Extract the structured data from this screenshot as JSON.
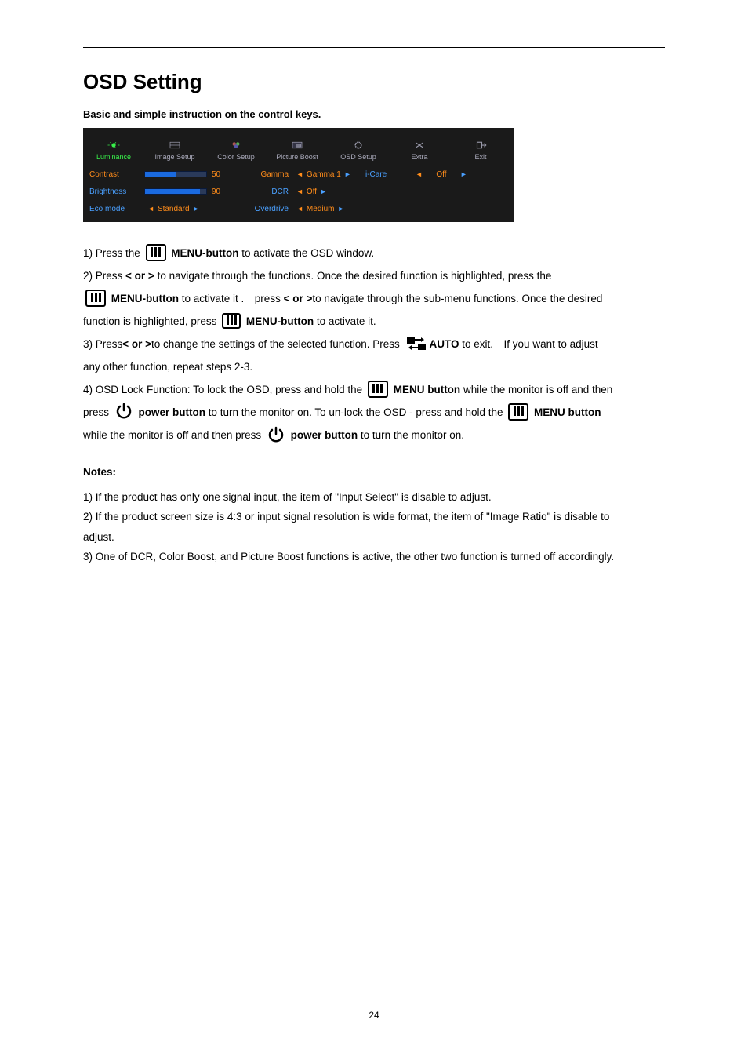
{
  "title": "OSD Setting",
  "subhead": "Basic and simple instruction on the control keys.",
  "page_number": "24",
  "osd": {
    "tabs": [
      "Luminance",
      "Image Setup",
      "Color Setup",
      "Picture Boost",
      "OSD Setup",
      "Extra",
      "Exit"
    ],
    "rows": [
      {
        "label": "Contrast",
        "value": "50"
      },
      {
        "label": "Brightness",
        "value": "90"
      },
      {
        "label": "Eco mode",
        "value": "Standard"
      }
    ],
    "rows2": [
      {
        "label": "Gamma",
        "value": "Gamma 1"
      },
      {
        "label": "DCR",
        "value": "Off"
      },
      {
        "label": "Overdrive",
        "value": "Medium"
      }
    ],
    "rows3": [
      {
        "label": "i-Care",
        "value": "Off"
      }
    ]
  },
  "labels": {
    "menu_button": "MENU-button",
    "menu_button2": "MENU button",
    "power_button": "power button",
    "auto": "AUTO",
    "lt_gt": "< or >"
  },
  "steps": {
    "s1": {
      "a": "1) Press the ",
      "b": " to activate the OSD window."
    },
    "s2": {
      "a": "2) Press ",
      "b": " to navigate through the functions. Once the desired function is highlighted, press the"
    },
    "s2c": {
      "a": " to activate it . press",
      "b": "to navigate through the sub-menu functions. Once the desired"
    },
    "s2d": {
      "a": "function is highlighted, press ",
      "b": " to activate it."
    },
    "s3": {
      "a": "3) Press",
      "b": "to change the settings of the selected function. Press ",
      "c": " to exit. If you want to adjust",
      "d": "any other function, repeat steps 2-3."
    },
    "s4": {
      "a": "4) OSD Lock Function: To lock the OSD, press and hold the ",
      "b": " while the monitor is off and then"
    },
    "s4c": {
      "a": "press ",
      "b": " to turn the monitor on. To un-lock the OSD - press and hold the "
    },
    "s4d": {
      "a": "while the monitor is off and then press ",
      "b": " to turn the monitor on."
    }
  },
  "notes": {
    "heading": "Notes:",
    "items": [
      "1) If the product has only one signal input, the item of \"Input Select\" is disable to adjust.",
      "2) If the product screen size is 4:3 or input signal resolution is wide format, the item of \"Image Ratio\" is disable to",
      "adjust.",
      "3) One of DCR, Color Boost, and Picture Boost functions is active, the other two function is turned off accordingly."
    ]
  }
}
